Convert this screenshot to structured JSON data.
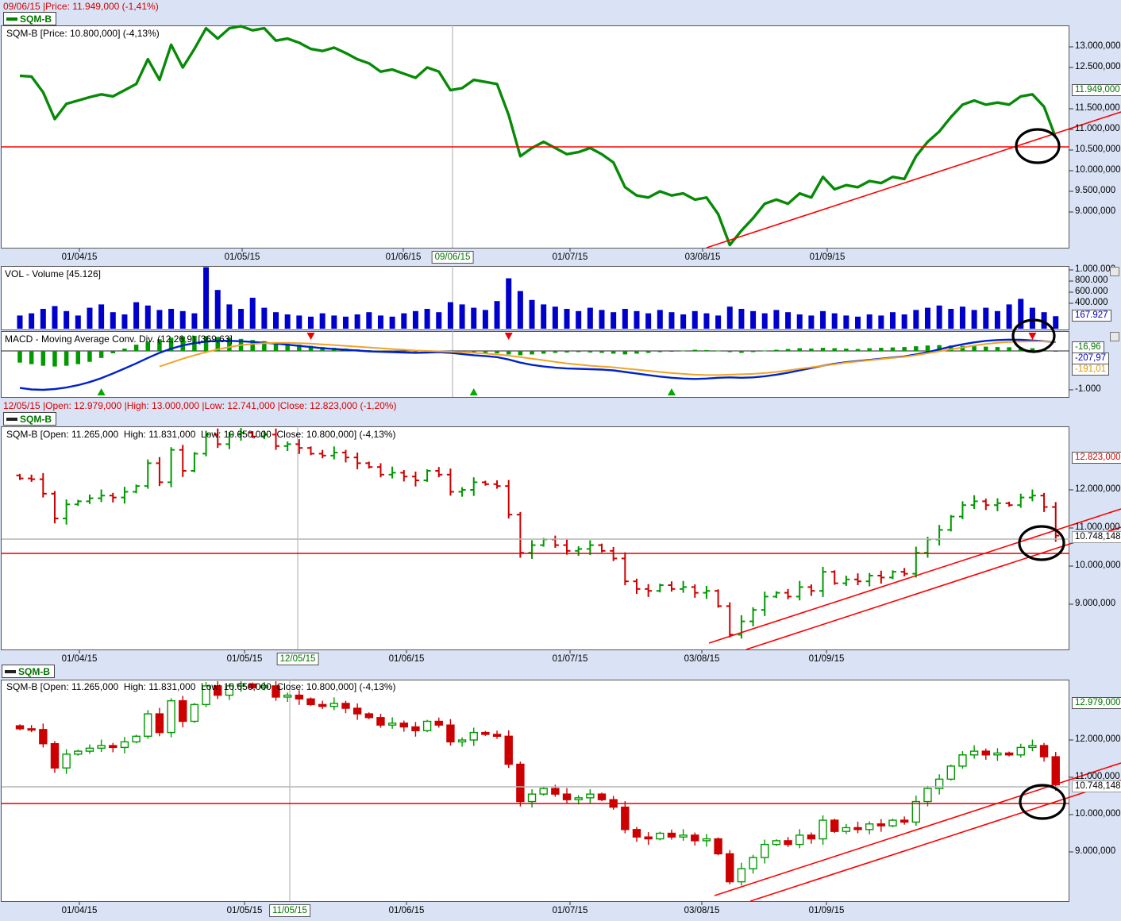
{
  "app": {
    "background": "#d9e3f5",
    "plot_background": "#ffffff"
  },
  "colors": {
    "up": "#009900",
    "down": "#cc0000",
    "price_line": "#078a07",
    "volume_bar": "#0000cc",
    "macd_line": "#0022cc",
    "signal_line": "#f0a428",
    "hist_bar": "#009900",
    "trend_red": "#ff0000",
    "level_dark_red": "#dd0000",
    "level_gray": "#b5b5b5",
    "crosshair": "#a8a8a8",
    "annotation_ellipse": "#000000"
  },
  "tabs": [
    {
      "label": "SQM-B"
    },
    {
      "label": "SQM-B"
    },
    {
      "label": "SQM-B"
    }
  ],
  "chart_data": [
    {
      "id": "price_line_chart",
      "type": "line",
      "symbol": "SQM-B",
      "info_line": "09/06/15 |Price: 11.949,000 (-1,41%)",
      "title": "SQM-B [Price: 10.800,000] (-4,13%)",
      "ylim": [
        8.1,
        13.5
      ],
      "yticks": [
        [
          "13.000,000",
          13
        ],
        [
          "12.500,000",
          12.5
        ],
        [
          "11.500,000",
          11.5
        ],
        [
          "11.000,000",
          11
        ],
        [
          "10.500,000",
          10.5
        ],
        [
          "10.000,000",
          10
        ],
        [
          "9.500,000",
          9.5
        ],
        [
          "9.000,000",
          9
        ]
      ],
      "ybox": {
        "label": "11.949,000",
        "value": 11.949,
        "color": "green"
      },
      "xticks": [
        [
          "01/04/15",
          100
        ],
        [
          "01/05/15",
          305
        ],
        [
          "01/06/15",
          508
        ],
        [
          "01/07/15",
          718
        ],
        [
          "03/08/15",
          885
        ],
        [
          "01/09/15",
          1042
        ]
      ],
      "xbox": {
        "label": "09/06/15",
        "x": 570
      },
      "crosshair_x": 570,
      "series_source": "series.price_close_millions",
      "annotations": {
        "horizontal_level": 10.58,
        "trendline": "rising support from low to upper right",
        "ellipse": "black circle at trendline breakdown"
      }
    },
    {
      "id": "volume_panel",
      "type": "bar",
      "title": "VOL - Volume [45.126]",
      "yticks": [
        [
          "1.000.000",
          1000
        ],
        [
          "800.000",
          800
        ],
        [
          "600.000",
          600
        ],
        [
          "400.000",
          400
        ]
      ],
      "ybox": {
        "label": "167.927",
        "value": 168,
        "color": "blue"
      },
      "series_source": "series.volume_thousands"
    },
    {
      "id": "macd_panel",
      "type": "macd",
      "title": "MACD - Moving Average Conv. Div. (12,26,9) [369,63]",
      "yticks": [
        [
          "-1.000",
          -1000
        ]
      ],
      "yboxes": [
        {
          "label": "-16,96",
          "color": "green",
          "y": 438
        },
        {
          "label": "-207,97",
          "color": "blue",
          "y": 452
        },
        {
          "label": "-191,01",
          "color": "orange",
          "y": 466
        }
      ],
      "series_source": "series.macd"
    },
    {
      "id": "ohlc_bar_chart",
      "type": "ohlc",
      "symbol": "SQM-B",
      "info_line": "12/05/15 |Open: 12.979,000 |High: 13.000,000 |Low: 12.741,000 |Close: 12.823,000 (-1,20%)",
      "title": "SQM-B [Open: 11.265,000  High: 11.831,000  Low: 10.650,000  Close: 10.800,000] (-4,13%)",
      "ylim": [
        7.8,
        13.7
      ],
      "yticks": [
        [
          "12.000,000",
          12
        ],
        [
          "11.000,000",
          11
        ],
        [
          "10.000,000",
          10
        ],
        [
          "9.000,000",
          9
        ]
      ],
      "yboxes": [
        {
          "label": "12.823,000",
          "value": 12.823,
          "color": "red"
        },
        {
          "label": "10.748,148",
          "value": 10.748148,
          "color": "gray"
        }
      ],
      "xticks": [
        [
          "01/04/15",
          100
        ],
        [
          "01/05/15",
          308
        ],
        [
          "01/06/15",
          512
        ],
        [
          "01/07/15",
          718
        ],
        [
          "03/08/15",
          884
        ],
        [
          "01/09/15",
          1041
        ]
      ],
      "xbox": {
        "label": "12/05/15",
        "x": 375
      },
      "crosshair_x": 375,
      "series_source": "series.price_close_millions",
      "annotations": {
        "gray_level": 10.748148,
        "red_level": 10.35,
        "trend_channel": "two rising red lines",
        "ellipse": "black circle at right end"
      }
    },
    {
      "id": "candlestick_chart",
      "type": "candle",
      "symbol": "SQM-B",
      "title": "SQM-B [Open: 11.265,000  High: 11.831,000  Low: 10.650,000  Close: 10.800,000] (-4,13%)",
      "ylim": [
        7.7,
        13.6
      ],
      "yticks": [
        [
          "12.000,000",
          12
        ],
        [
          "11.000,000",
          11
        ],
        [
          "10.000,000",
          10
        ],
        [
          "9.000,000",
          9
        ]
      ],
      "yboxes": [
        {
          "label": "12.979,000",
          "value": 12.979,
          "color": "green"
        },
        {
          "label": "10.748,148",
          "value": 10.748148,
          "color": "gray"
        }
      ],
      "xticks": [
        [
          "01/04/15",
          100
        ],
        [
          "01/05/15",
          308
        ],
        [
          "01/06/15",
          512
        ],
        [
          "01/07/15",
          718
        ],
        [
          "03/08/15",
          884
        ],
        [
          "01/09/15",
          1041
        ]
      ],
      "xbox": {
        "label": "11/05/15",
        "x": 365
      },
      "crosshair_x": 365,
      "series_source": "series.price_close_millions",
      "annotations": {
        "gray_level": 10.748148,
        "red_level": 10.3,
        "trend_channel": "two rising red lines",
        "ellipse": "black circle at right end"
      }
    }
  ],
  "series": {
    "price_close_millions": [
      12.3,
      12.28,
      11.9,
      11.25,
      11.62,
      11.7,
      11.78,
      11.85,
      11.8,
      11.95,
      12.1,
      12.7,
      12.2,
      13.05,
      12.5,
      12.95,
      13.45,
      13.2,
      13.45,
      13.5,
      13.4,
      13.45,
      13.15,
      13.2,
      13.1,
      12.95,
      12.9,
      12.98,
      12.85,
      12.7,
      12.6,
      12.4,
      12.45,
      12.35,
      12.25,
      12.5,
      12.4,
      11.95,
      12.0,
      12.2,
      12.15,
      12.1,
      11.35,
      10.35,
      10.55,
      10.7,
      10.55,
      10.4,
      10.45,
      10.55,
      10.4,
      10.2,
      9.6,
      9.4,
      9.35,
      9.5,
      9.4,
      9.45,
      9.3,
      9.35,
      8.95,
      8.2,
      8.55,
      8.85,
      9.2,
      9.3,
      9.2,
      9.45,
      9.35,
      9.85,
      9.55,
      9.65,
      9.6,
      9.75,
      9.7,
      9.85,
      9.8,
      10.35,
      10.7,
      10.95,
      11.3,
      11.6,
      11.7,
      11.6,
      11.65,
      11.6,
      11.8,
      11.85,
      11.55,
      10.8
    ],
    "volume_thousands": [
      180,
      220,
      300,
      350,
      260,
      180,
      320,
      380,
      240,
      200,
      420,
      360,
      280,
      300,
      260,
      220,
      1050,
      640,
      380,
      300,
      500,
      320,
      240,
      200,
      180,
      160,
      220,
      180,
      160,
      200,
      240,
      180,
      160,
      220,
      260,
      300,
      240,
      420,
      380,
      320,
      280,
      440,
      850,
      620,
      460,
      380,
      340,
      300,
      260,
      320,
      280,
      240,
      300,
      260,
      220,
      280,
      240,
      200,
      260,
      220,
      180,
      340,
      300,
      260,
      220,
      280,
      240,
      200,
      180,
      260,
      220,
      180,
      160,
      200,
      180,
      240,
      200,
      280,
      320,
      360,
      300,
      340,
      280,
      320,
      260,
      380,
      480,
      320,
      240,
      168
    ],
    "macd": {
      "hist": [
        -300,
        -340,
        -380,
        -400,
        -380,
        -340,
        -280,
        -180,
        -60,
        60,
        160,
        240,
        300,
        340,
        370,
        390,
        380,
        360,
        340,
        310,
        280,
        250,
        220,
        190,
        160,
        130,
        100,
        80,
        60,
        40,
        20,
        10,
        -10,
        -20,
        -30,
        -20,
        -10,
        -20,
        -40,
        -60,
        -50,
        -60,
        -90,
        -110,
        -90,
        -70,
        -50,
        -40,
        -30,
        -40,
        -50,
        -70,
        -90,
        -70,
        -50,
        -30,
        -10,
        10,
        30,
        20,
        10,
        -30,
        -50,
        -30,
        10,
        30,
        50,
        70,
        60,
        80,
        70,
        60,
        50,
        70,
        80,
        90,
        100,
        120,
        140,
        150,
        140,
        130,
        120,
        110,
        100,
        95,
        90,
        70,
        40,
        -17
      ],
      "macd_line": [
        -950,
        -990,
        -1000,
        -980,
        -940,
        -880,
        -800,
        -700,
        -580,
        -450,
        -320,
        -180,
        -50,
        60,
        140,
        200,
        240,
        260,
        260,
        250,
        230,
        210,
        190,
        160,
        130,
        100,
        70,
        50,
        30,
        10,
        -10,
        -20,
        -30,
        -40,
        -50,
        -40,
        -30,
        -50,
        -80,
        -110,
        -130,
        -160,
        -220,
        -300,
        -360,
        -400,
        -430,
        -450,
        -460,
        -470,
        -480,
        -500,
        -540,
        -580,
        -620,
        -660,
        -690,
        -710,
        -720,
        -710,
        -690,
        -680,
        -690,
        -680,
        -650,
        -610,
        -560,
        -500,
        -440,
        -380,
        -330,
        -290,
        -260,
        -230,
        -200,
        -170,
        -140,
        -90,
        -30,
        40,
        110,
        170,
        220,
        260,
        280,
        290,
        285,
        270,
        250,
        230
      ],
      "signal_line": [
        null,
        null,
        null,
        null,
        null,
        null,
        null,
        null,
        null,
        null,
        null,
        null,
        -400,
        -300,
        -200,
        -110,
        -30,
        40,
        100,
        150,
        180,
        200,
        210,
        210,
        200,
        190,
        170,
        150,
        130,
        110,
        90,
        70,
        50,
        30,
        10,
        0,
        -10,
        -20,
        -30,
        -50,
        -70,
        -90,
        -120,
        -160,
        -200,
        -240,
        -280,
        -320,
        -350,
        -380,
        -400,
        -420,
        -450,
        -480,
        -510,
        -540,
        -570,
        -590,
        -610,
        -620,
        -620,
        -610,
        -600,
        -590,
        -570,
        -540,
        -500,
        -460,
        -420,
        -380,
        -340,
        -300,
        -270,
        -240,
        -210,
        -180,
        -150,
        -110,
        -60,
        -10,
        40,
        90,
        140,
        180,
        210,
        230,
        240,
        245,
        245,
        240
      ],
      "up_arrow_idx": [
        7,
        39,
        56
      ],
      "down_arrow_idx": [
        25,
        42,
        87
      ]
    }
  }
}
